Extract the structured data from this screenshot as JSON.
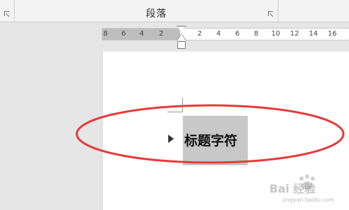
{
  "ribbon": {
    "group_label": "段落"
  },
  "ruler": {
    "ticks": [
      "8",
      "6",
      "4",
      "2",
      "2",
      "4",
      "6",
      "8",
      "10",
      "12",
      "14",
      "16"
    ]
  },
  "document": {
    "heading_text": "标题字符"
  },
  "watermark": {
    "text": "Bai 经验",
    "sub": "jingyan.baidu.com"
  },
  "colors": {
    "highlight": "#e53a3a",
    "selection": "#c8c8c8",
    "ruler_margin": "#bdbdbd"
  }
}
